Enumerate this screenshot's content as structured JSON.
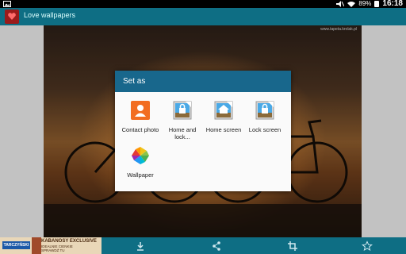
{
  "status_bar": {
    "battery": "89%",
    "time": "16:18"
  },
  "app": {
    "title": "Love wallpapers"
  },
  "wallpaper": {
    "watermark": "www.tapeta.krolak.pl"
  },
  "dialog": {
    "title": "Set as",
    "options": [
      {
        "label": "Contact photo",
        "icon": "contact-icon"
      },
      {
        "label": "Home and lock...",
        "icon": "home-lock-icon"
      },
      {
        "label": "Home screen",
        "icon": "home-icon"
      },
      {
        "label": "Lock screen",
        "icon": "lock-icon"
      },
      {
        "label": "Wallpaper",
        "icon": "pinwheel-icon"
      }
    ]
  },
  "ad": {
    "brand": "TARCZYŃSKI",
    "line1": "KABANOSY EXCLUSIVE",
    "line2": "IDEALNIE CIENKIE",
    "line3": "SPRAWDŹ TU"
  },
  "colors": {
    "action_bar": "#0e6e84",
    "dialog_header": "#18678c"
  }
}
